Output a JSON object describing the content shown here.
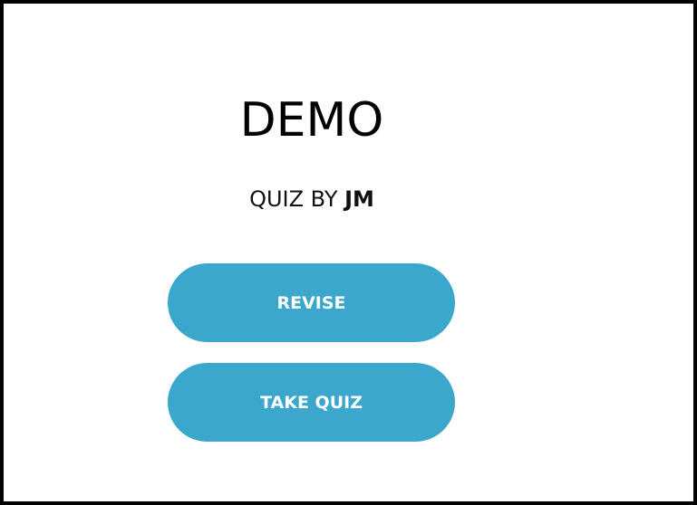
{
  "header": {
    "title": "DEMO",
    "subtitle_prefix": "QUIZ BY",
    "author": "JM"
  },
  "actions": {
    "revise_label": "REVISE",
    "take_quiz_label": "TAKE QUIZ"
  },
  "colors": {
    "button": "#3ba7cc",
    "button_text": "#ffffff",
    "border": "#000000"
  }
}
